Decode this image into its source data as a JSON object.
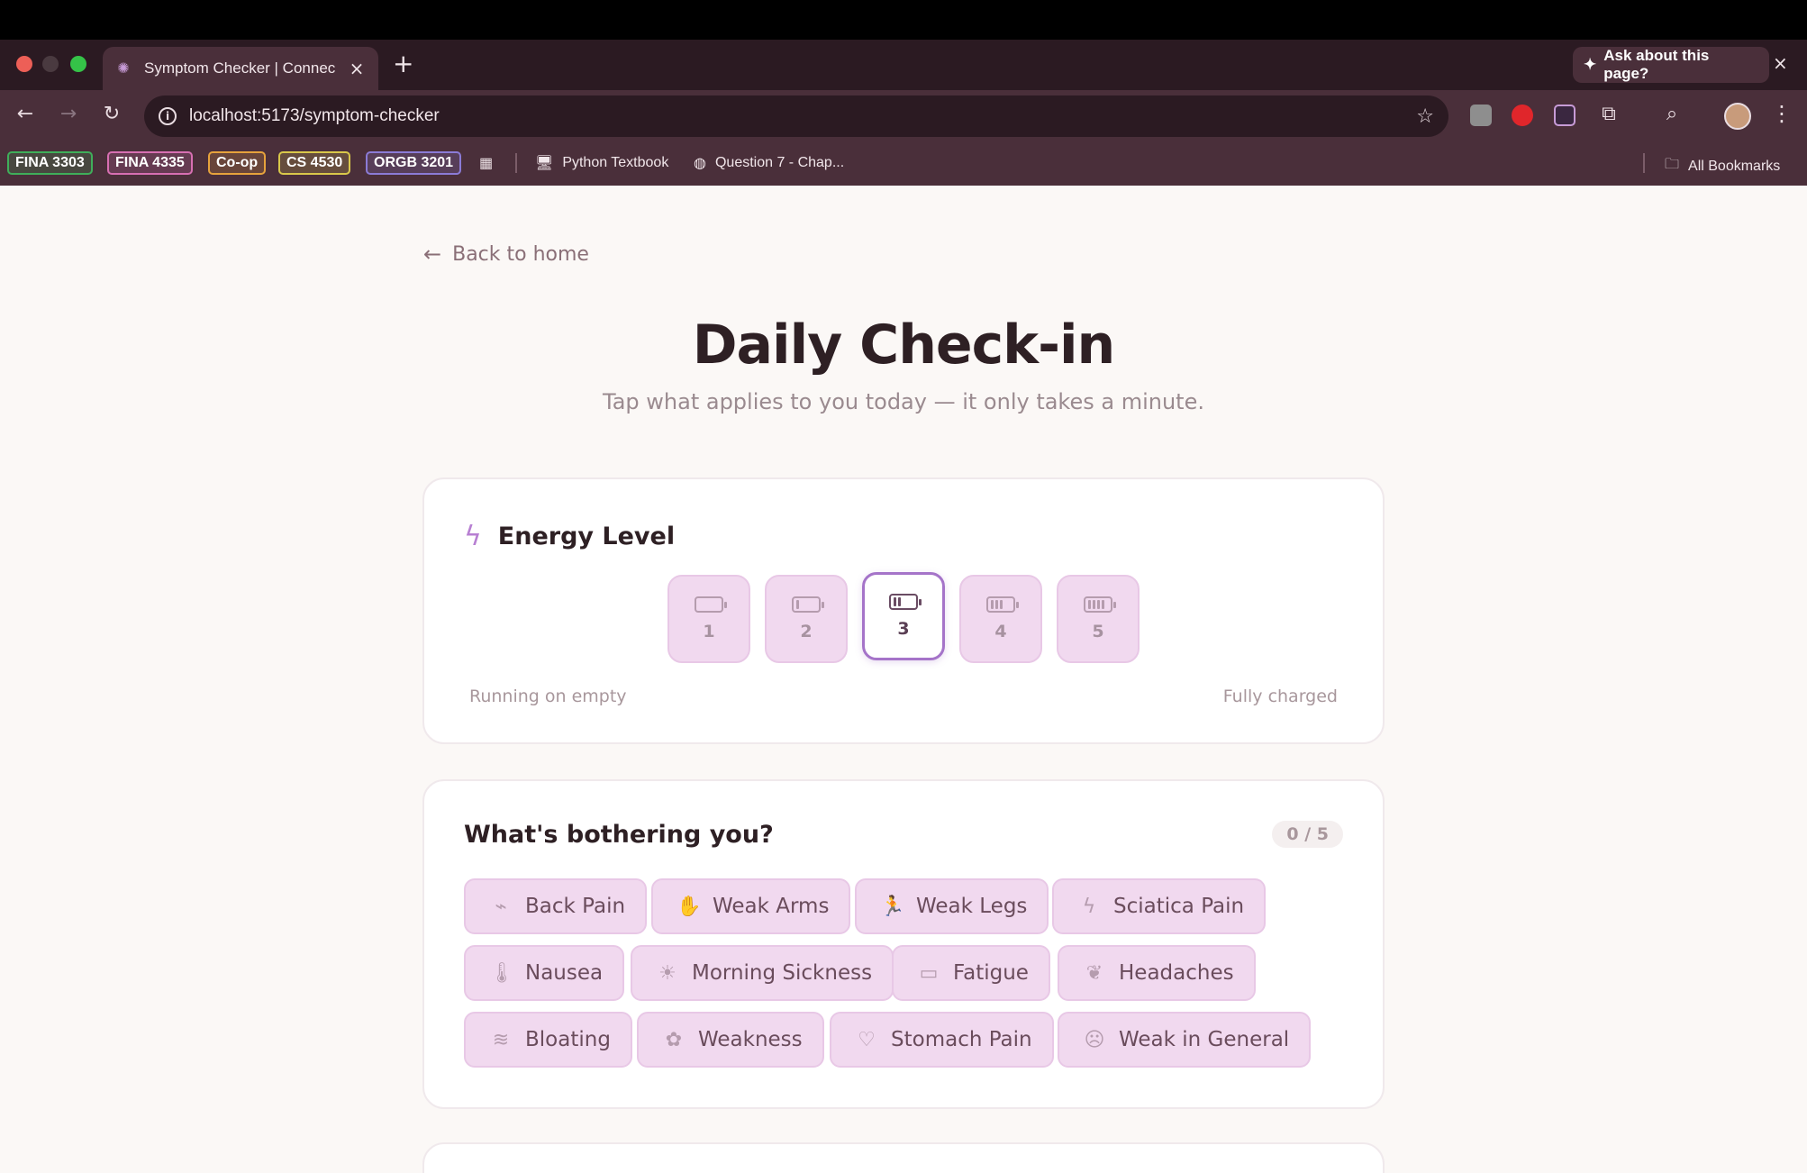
{
  "browser": {
    "tab_title": "Symptom Checker | Connecti",
    "url": "localhost:5173/symptom-checker",
    "ask_label": "Ask about this page?",
    "bookmarks": [
      {
        "label": "FINA 3303",
        "color": "#3fae5a"
      },
      {
        "label": "FINA 4335",
        "color": "#d76fb2"
      },
      {
        "label": "Co-op",
        "color": "#e6a23c"
      },
      {
        "label": "CS 4530",
        "color": "#d9c84a"
      },
      {
        "label": "ORGB 3201",
        "color": "#8b7bd6"
      }
    ],
    "bookmark_links": [
      "Python Textbook",
      "Question 7 - Chap..."
    ],
    "all_bookmarks": "All Bookmarks"
  },
  "page": {
    "back_label": "Back to home",
    "title": "Daily Check-in",
    "subtitle": "Tap what applies to you today — it only takes a minute."
  },
  "energy": {
    "title": "Energy Level",
    "levels": [
      "1",
      "2",
      "3",
      "4",
      "5"
    ],
    "selected": 3,
    "low_label": "Running on empty",
    "high_label": "Fully charged"
  },
  "symptoms": {
    "title": "What's bothering you?",
    "count": "0 / 5",
    "items": [
      {
        "label": "Back Pain",
        "icon": "bone-icon"
      },
      {
        "label": "Weak Arms",
        "icon": "hand-icon"
      },
      {
        "label": "Weak Legs",
        "icon": "running-icon"
      },
      {
        "label": "Sciatica Pain",
        "icon": "bolt-icon"
      },
      {
        "label": "Nausea",
        "icon": "thermometer-icon"
      },
      {
        "label": "Morning Sickness",
        "icon": "sunrise-icon"
      },
      {
        "label": "Fatigue",
        "icon": "battery-icon"
      },
      {
        "label": "Headaches",
        "icon": "brain-icon"
      },
      {
        "label": "Bloating",
        "icon": "wind-icon"
      },
      {
        "label": "Weakness",
        "icon": "flower-icon"
      },
      {
        "label": "Stomach Pain",
        "icon": "heart-icon"
      },
      {
        "label": "Weak in General",
        "icon": "face-icon"
      }
    ]
  }
}
